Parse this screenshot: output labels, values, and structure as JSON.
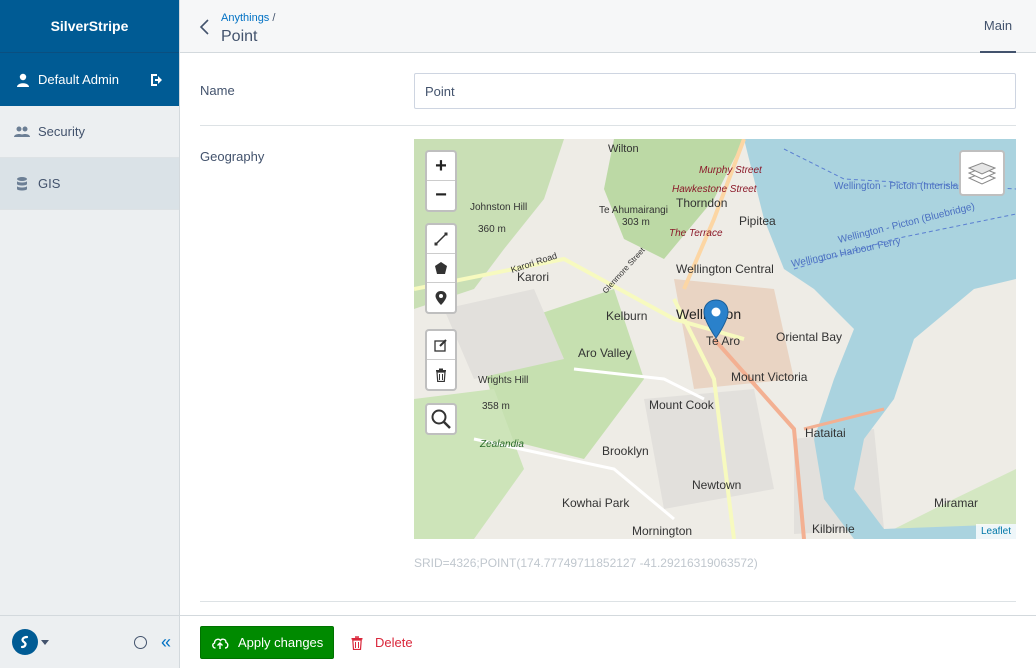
{
  "sidebar": {
    "brand": "SilverStripe",
    "user": {
      "name": "Default Admin",
      "icon": "user-icon",
      "logout_icon": "logout-icon"
    },
    "items": [
      {
        "label": "Security",
        "icon": "users-icon",
        "active": false
      },
      {
        "label": "GIS",
        "icon": "database-icon",
        "active": true
      }
    ],
    "footer": {
      "logo_icon": "silverstripe-logo-icon",
      "circle_icon": "circle-icon",
      "collapse_icon": "double-chevron-left-icon",
      "collapse_glyph": "«"
    }
  },
  "header": {
    "breadcrumb": "Anythings",
    "breadcrumb_sep": "/",
    "title": "Point",
    "tabs": [
      {
        "label": "Main",
        "active": true
      }
    ]
  },
  "form": {
    "name_label": "Name",
    "name_value": "Point",
    "geography_label": "Geography",
    "srid_text": "SRID=4326;POINT(174.77749711852127 -41.29216319063572)"
  },
  "map": {
    "zoom_in": "+",
    "zoom_out": "−",
    "attribution": "Leaflet",
    "place_labels": [
      "Wilton",
      "Murphy Street",
      "Hawkestone Street",
      "Thorndon",
      "Pipitea",
      "Johnston Hill",
      "360 m",
      "Te Ahumairangi",
      "303 m",
      "The Terrace",
      "Karori Road",
      "Karori",
      "Glenmore Street",
      "Wellington Central",
      "Wellington",
      "Kelburn",
      "Te Aro",
      "Oriental Bay",
      "Aro Valley",
      "Wrights Hill",
      "358 m",
      "Mount Victoria",
      "Mount Cook",
      "Hataitai",
      "Zealandia",
      "Brooklyn",
      "Newtown",
      "Kowhai Park",
      "Mornington",
      "Kilbirnie",
      "Miramar",
      "Wellington - Picton (Interislander)",
      "Wellington - Picton (Bluebridge)",
      "Wellington Harbour Ferry"
    ],
    "marker_color": "#2a81cb"
  },
  "actions": {
    "apply_label": "Apply changes",
    "delete_label": "Delete"
  },
  "colors": {
    "brand": "#005b94",
    "link": "#0071c4",
    "apply": "#008a00",
    "delete": "#da273b",
    "water": "#aad3df"
  }
}
